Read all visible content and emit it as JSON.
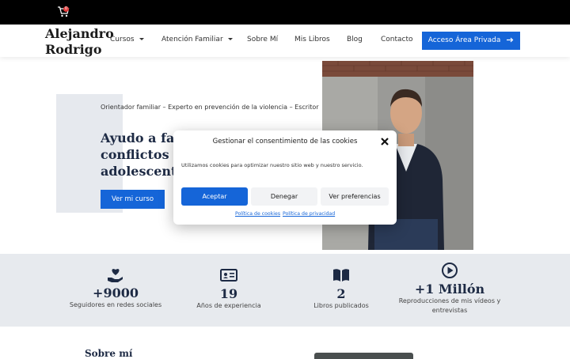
{
  "topbar": {
    "cart_icon": "cart-icon",
    "cart_count": "0"
  },
  "header": {
    "logo_line1": "Alejandro",
    "logo_line2": "Rodrigo",
    "nav": [
      {
        "label": "Cursos"
      },
      {
        "label": "Atención Familiar"
      },
      {
        "label": "Sobre Mí"
      },
      {
        "label": "Mis Libros"
      },
      {
        "label": "Blog"
      },
      {
        "label": "Contacto"
      }
    ],
    "cta_label": "Acceso Área Privada",
    "cta_icon": "arrow-right-icon"
  },
  "hero": {
    "subtitle": "Orientador familiar – Experto en prevención de la violencia – Escritor",
    "title_line1": "Ayudo a fam",
    "title_line2": "conflictos co",
    "title_line3": "adolescentes",
    "button_label": "Ver mi curso"
  },
  "stats": [
    {
      "icon": "heart-hand-icon",
      "number": "+9000",
      "label": "Seguidores en redes sociales"
    },
    {
      "icon": "id-card-icon",
      "number": "19",
      "label": "Años de experiencia"
    },
    {
      "icon": "book-icon",
      "number": "2",
      "label": "Libros publicados"
    },
    {
      "icon": "play-circle-icon",
      "number": "+1 Millón",
      "label_line1": "Reproducciones de mis vídeos y",
      "label_line2": "entrevistas"
    }
  ],
  "about": {
    "heading": "Sobre mí"
  },
  "cookie_modal": {
    "title": "Gestionar el consentimiento de las cookies",
    "text": "Utilizamos cookies para optimizar nuestro sitio web y nuestro servicio.",
    "accept_label": "Aceptar",
    "deny_label": "Denegar",
    "prefs_label": "Ver preferencias",
    "cookie_policy_label": "Política de cookies",
    "privacy_policy_label": "Política de privacidad"
  },
  "colors": {
    "accent": "#1565d8",
    "dark_text": "#1d2a44",
    "topbar": "#000000",
    "stats_bg": "#e7eaee"
  }
}
